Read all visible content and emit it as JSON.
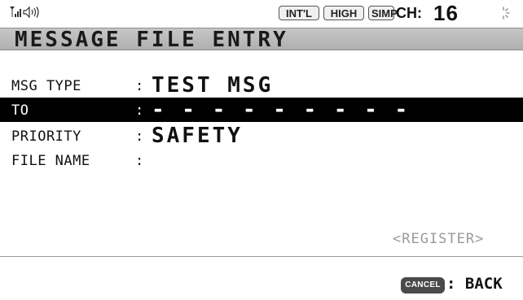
{
  "status_bar": {
    "badges": [
      "INT'L",
      "HIGH",
      "SIMP"
    ],
    "channel_label": "CH:",
    "channel_value": "16"
  },
  "screen": {
    "title": "MESSAGE FILE ENTRY"
  },
  "fields": [
    {
      "label": "MSG TYPE",
      "colon": ":",
      "value": "TEST MSG"
    },
    {
      "label": "TO",
      "colon": ":",
      "value": "- - - - - - - - -"
    },
    {
      "label": "PRIORITY",
      "colon": ":",
      "value": "SAFETY"
    },
    {
      "label": "FILE NAME",
      "colon": ":",
      "value": ""
    }
  ],
  "selected_field_index": 1,
  "actions": {
    "register_label": "<REGISTER>"
  },
  "footer": {
    "cancel_key": "CANCEL",
    "back_label": ": BACK"
  },
  "colors": {
    "titlebar": "#b8b8b8",
    "selected_row_bg": "#000000",
    "selected_row_text": "#ffffff"
  }
}
